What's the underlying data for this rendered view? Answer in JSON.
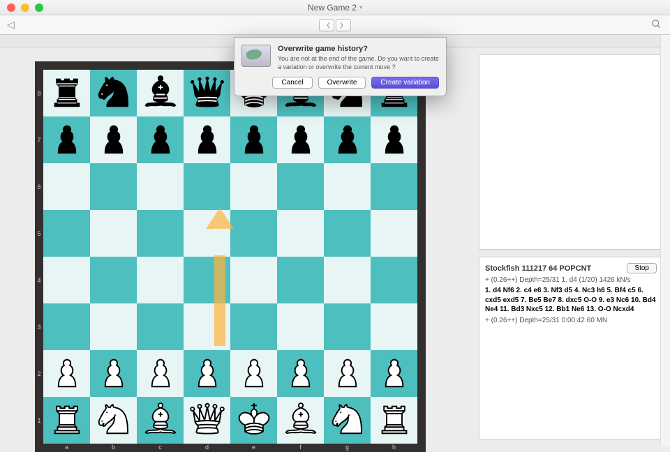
{
  "window": {
    "title": "New Game 2",
    "tab": "New Game 2"
  },
  "board": {
    "ranks": [
      "8",
      "7",
      "6",
      "5",
      "4",
      "3",
      "2",
      "1"
    ],
    "files": [
      "a",
      "b",
      "c",
      "d",
      "e",
      "f",
      "g",
      "h"
    ],
    "light_color": "#e8f5f5",
    "dark_color": "#4dbfbf",
    "position_fen": "rnbqkbnr/pppppppp/8/8/8/8/PPPPPPPP/RNBQKBNR",
    "arrow": {
      "from": "d2",
      "to": "d4",
      "color": "rgba(255,180,60,0.7)"
    }
  },
  "dialog": {
    "title": "Overwrite game history?",
    "body": "You are not at the end of the game. Do you want to create a variation or overwrite the current move ?",
    "buttons": {
      "cancel": "Cancel",
      "overwrite": "Overwrite",
      "create": "Create variation"
    }
  },
  "engine": {
    "name": "Stockfish 111217 64 POPCNT",
    "stop_label": "Stop",
    "line1": "+ (0.26++)    Depth=25/31    1. d4 (1/20)    1426 kN/s",
    "pv": "1. d4 Nf6 2. c4 e6 3. Nf3 d5 4. Nc3 h6 5. Bf4 c5 6. cxd5 exd5 7. Be5 Be7 8. dxc5 O-O 9. e3 Nc6 10. Bd4 Ne4 11. Bd3 Nxc5 12. Bb1 Ne6 13. O-O Ncxd4",
    "line2": "+ (0.26++)    Depth=25/31    0:00:42    60 MN"
  }
}
